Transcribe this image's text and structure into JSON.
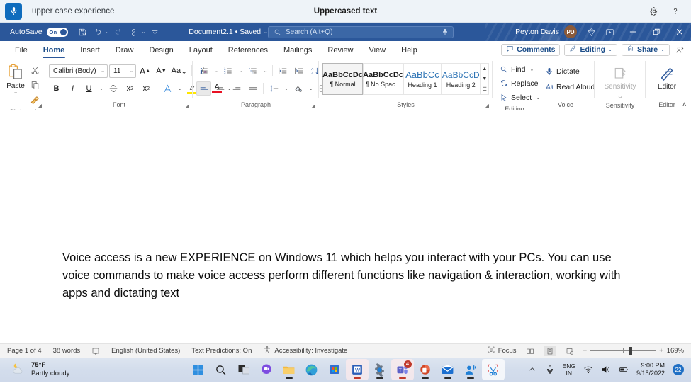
{
  "voice_access": {
    "mic_icon": "microphone-icon",
    "command_text": "upper case experience",
    "title": "Uppercased text",
    "settings_icon": "gear-icon",
    "help_icon": "help-icon"
  },
  "word_titlebar": {
    "autosave_label": "AutoSave",
    "autosave_state": "On",
    "quick_access": [
      {
        "name": "save-button",
        "icon": "save-icon"
      },
      {
        "name": "undo-button",
        "icon": "undo-icon"
      },
      {
        "name": "redo-button",
        "icon": "redo-icon"
      },
      {
        "name": "touch-mode-button",
        "icon": "touch-icon"
      },
      {
        "name": "customize-qat-button",
        "icon": "chevron-down-icon"
      }
    ],
    "document_name": "Document2.1 • Saved",
    "search_placeholder": "Search (Alt+Q)",
    "search_icon": "search-icon",
    "dictate_mic_icon": "microphone-icon",
    "user_name": "Peyton Davis",
    "user_initials": "PD",
    "diamond_icon": "diamond-icon",
    "ribbon_display_icon": "ribbon-display-options-icon",
    "minimize_label": "minimize-icon",
    "restore_label": "restore-icon",
    "close_label": "close-icon",
    "accent": "#2b579a"
  },
  "tabs": [
    {
      "label": "File",
      "active": false
    },
    {
      "label": "Home",
      "active": true
    },
    {
      "label": "Insert",
      "active": false
    },
    {
      "label": "Draw",
      "active": false
    },
    {
      "label": "Design",
      "active": false
    },
    {
      "label": "Layout",
      "active": false
    },
    {
      "label": "References",
      "active": false
    },
    {
      "label": "Mailings",
      "active": false
    },
    {
      "label": "Review",
      "active": false
    },
    {
      "label": "View",
      "active": false
    },
    {
      "label": "Help",
      "active": false
    }
  ],
  "tabs_right": {
    "comments_label": "Comments",
    "editing_label": "Editing",
    "share_label": "Share",
    "caret": "⌄",
    "share_person_icon": "share-person-icon"
  },
  "ribbon": {
    "clipboard": {
      "group_name": "Clipboard",
      "paste_label": "Paste",
      "paste_caret": "⌄",
      "cut_icon": "scissors-icon",
      "copy_icon": "copy-icon",
      "format_painter_icon": "format-painter-icon",
      "dialog_launcher": "dialog-launcher-icon"
    },
    "font": {
      "group_name": "Font",
      "font_family": "Calibri (Body)",
      "font_size": "11",
      "grow_font": "A",
      "shrink_font": "A",
      "change_case": "Aa",
      "clear_formatting_icon": "clear-formatting-icon",
      "bold": "B",
      "italic": "I",
      "underline": "U",
      "strikethrough_icon": "strikethrough-icon",
      "subscript": "x",
      "superscript": "x",
      "text_effects_icon": "text-effects-icon",
      "highlight_icon": "text-highlight-icon",
      "font_color_icon": "font-color-icon",
      "highlight_color": "#ffe600",
      "font_color": "#e81123",
      "dialog_launcher": "dialog-launcher-icon"
    },
    "paragraph": {
      "group_name": "Paragraph",
      "bullets_icon": "bullet-list-icon",
      "numbering_icon": "numbered-list-icon",
      "multilevel_icon": "multilevel-list-icon",
      "decrease_indent_icon": "decrease-indent-icon",
      "increase_indent_icon": "increase-indent-icon",
      "sort_icon": "sort-icon",
      "show_marks_icon": "pilcrow-icon",
      "align_left_icon": "align-left-icon",
      "align_center_icon": "align-center-icon",
      "align_right_icon": "align-right-icon",
      "justify_icon": "justify-icon",
      "line_spacing_icon": "line-spacing-icon",
      "shading_icon": "shading-icon",
      "borders_icon": "borders-icon",
      "dialog_launcher": "dialog-launcher-icon"
    },
    "styles": {
      "group_name": "Styles",
      "items": [
        {
          "preview": "AaBbCcDc",
          "name": "¶ Normal",
          "selected": true,
          "kind": "normal"
        },
        {
          "preview": "AaBbCcDc",
          "name": "¶ No Spac...",
          "selected": false,
          "kind": "normal"
        },
        {
          "preview": "AaBbCc",
          "name": "Heading 1",
          "selected": false,
          "kind": "h1"
        },
        {
          "preview": "AaBbCcD",
          "name": "Heading 2",
          "selected": false,
          "kind": "h2"
        }
      ],
      "scroll_up": "▲",
      "scroll_down": "▼",
      "more": "☰",
      "dialog_launcher": "dialog-launcher-icon"
    },
    "editing": {
      "group_name": "Editing",
      "find_label": "Find",
      "replace_label": "Replace",
      "select_label": "Select",
      "find_icon": "find-icon",
      "replace_icon": "replace-icon",
      "select_icon": "select-cursor-icon",
      "caret": "⌄"
    },
    "voice": {
      "group_name": "Voice",
      "dictate_label": "Dictate",
      "read_aloud_label": "Read Aloud",
      "dictate_icon": "microphone-icon",
      "read_aloud_icon": "read-aloud-icon"
    },
    "sensitivity": {
      "group_name": "Sensitivity",
      "label": "Sensitivity",
      "icon": "sensitivity-icon",
      "caret": "⌄",
      "disabled": true
    },
    "editor": {
      "group_name": "Editor",
      "label": "Editor",
      "icon": "editor-pen-icon"
    },
    "collapse_ribbon": "∧"
  },
  "document": {
    "body_text": "Voice access is a new EXPERIENCE on Windows 11 which helps you interact with your PCs. You can use voice commands to make voice access perform different functions like navigation & interaction, working with apps and dictating text"
  },
  "status_bar": {
    "page": "Page 1 of 4",
    "words": "38 words",
    "proofing_icon": "proofing-icon",
    "language": "English (United States)",
    "text_predictions": "Text Predictions: On",
    "accessibility_icon": "accessibility-icon",
    "accessibility": "Accessibility: Investigate",
    "focus_label": "Focus",
    "focus_icon": "focus-icon",
    "read_mode_icon": "read-mode-icon",
    "print_layout_icon": "print-layout-icon",
    "web_layout_icon": "web-layout-icon",
    "zoom_out": "−",
    "zoom_in": "+",
    "zoom_level": "169%"
  },
  "taskbar": {
    "weather_temp": "75°F",
    "weather_desc": "Partly cloudy",
    "weather_icon": "partly-cloudy-icon",
    "apps": [
      {
        "name": "start-button",
        "icon": "windows-start-icon",
        "state": "none"
      },
      {
        "name": "search-button",
        "icon": "search-icon",
        "state": "none"
      },
      {
        "name": "task-view-button",
        "icon": "task-view-icon",
        "state": "none"
      },
      {
        "name": "chat-button",
        "icon": "chat-icon",
        "state": "none"
      },
      {
        "name": "file-explorer-button",
        "icon": "file-explorer-icon",
        "state": "running"
      },
      {
        "name": "edge-button",
        "icon": "edge-icon",
        "state": "none"
      },
      {
        "name": "microsoft-store-button",
        "icon": "microsoft-store-icon",
        "state": "none"
      },
      {
        "name": "word-button",
        "icon": "word-icon",
        "state": "active"
      },
      {
        "name": "settings-button",
        "icon": "settings-gear-icon",
        "state": "running"
      },
      {
        "name": "teams-button",
        "icon": "teams-icon",
        "state": "active",
        "badge": "4"
      },
      {
        "name": "powerpoint-button",
        "icon": "powerpoint-icon",
        "state": "running"
      },
      {
        "name": "mail-button",
        "icon": "mail-icon",
        "state": "running"
      },
      {
        "name": "voice-access-button",
        "icon": "voice-access-icon",
        "state": "running"
      },
      {
        "name": "snipping-tool-button",
        "icon": "snipping-tool-icon",
        "state": "focused"
      }
    ],
    "tray": {
      "show_hidden_icon": "chevron-up-icon",
      "microphone_icon": "microphone-icon",
      "language": "ENG",
      "language_sub": "IN",
      "wifi_icon": "wifi-icon",
      "volume_icon": "volume-icon",
      "battery_icon": "battery-icon",
      "time": "9:00 PM",
      "date": "9/15/2022",
      "notification_count": "22"
    }
  }
}
